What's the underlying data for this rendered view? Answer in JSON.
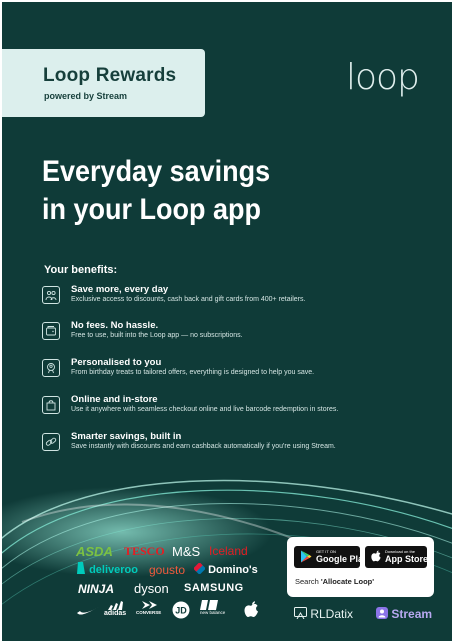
{
  "brand": {
    "title": "Loop Rewards",
    "subtitle": "powered by Stream",
    "logo_text": "loop"
  },
  "headline": {
    "line1": "Everyday savings",
    "line2": "in your Loop app"
  },
  "benefits": {
    "heading": "Your benefits:",
    "items": [
      {
        "title": "Save more, every day",
        "desc": "Exclusive access to discounts, cash back and gift cards from 400+ retailers.",
        "icon": "gift-people-icon"
      },
      {
        "title": "No fees. No hassle.",
        "desc": "Free to use, built into the Loop app — no subscriptions.",
        "icon": "wallet-icon"
      },
      {
        "title": "Personalised to you",
        "desc": "From birthday treats to tailored offers, everything is designed to help you save.",
        "icon": "person-badge-icon"
      },
      {
        "title": "Online and in-store",
        "desc": "Use it anywhere with seamless checkout online and live barcode redemption in stores.",
        "icon": "shopping-bag-icon"
      },
      {
        "title": "Smarter savings, built in",
        "desc": "Save instantly with discounts and earn cashback automatically if you're using Stream.",
        "icon": "link-icon"
      }
    ]
  },
  "retailers": {
    "asda": "ASDA",
    "tesco": "TESCO",
    "ms": "M&S",
    "iceland": "Iceland",
    "deliveroo": "deliveroo",
    "gousto": "gousto",
    "dominos": "Domino's",
    "ninja": "NINJA",
    "dyson": "dyson",
    "samsung": "SAMSUNG",
    "adidas": "adidas",
    "converse": "CONVERSE",
    "newbalance": "new balance"
  },
  "stores": {
    "google_small": "GET IT ON",
    "google_big": "Google Play",
    "apple_small": "Download on the",
    "apple_big": "App Store",
    "search_prefix": "Search ",
    "search_term": "'Allocate Loop'"
  },
  "footer": {
    "rldatix": "RLDatix",
    "stream": "Stream"
  },
  "colors": {
    "background": "#0f3b38",
    "brand_box": "#dcefed",
    "swirl": "#7fe3cf",
    "asda": "#7cc242",
    "tesco": "#e31e24",
    "iceland": "#e31e24",
    "deliveroo": "#00ccbc",
    "gousto": "#f05a3c",
    "stream": "#8b74e8"
  }
}
